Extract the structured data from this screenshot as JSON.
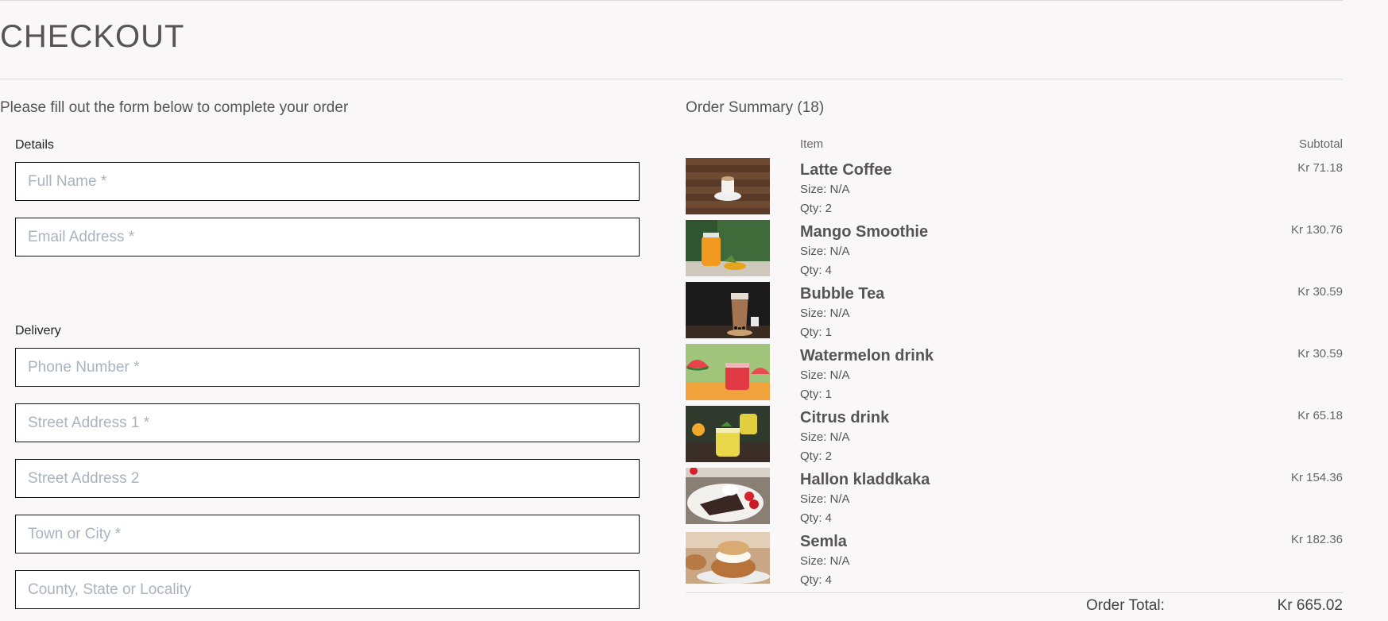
{
  "page": {
    "title": "CHECKOUT"
  },
  "form": {
    "intro": "Please fill out the form below to complete your order",
    "details_legend": "Details",
    "delivery_legend": "Delivery",
    "full_name": {
      "placeholder": "Full Name *",
      "value": ""
    },
    "email": {
      "placeholder": "Email Address *",
      "value": ""
    },
    "phone": {
      "placeholder": "Phone Number *",
      "value": ""
    },
    "street1": {
      "placeholder": "Street Address 1 *",
      "value": ""
    },
    "street2": {
      "placeholder": "Street Address 2",
      "value": ""
    },
    "town": {
      "placeholder": "Town or City *",
      "value": ""
    },
    "county": {
      "placeholder": "County, State or Locality",
      "value": ""
    }
  },
  "summary": {
    "title": "Order Summary (18)",
    "col_item": "Item",
    "col_subtotal": "Subtotal",
    "items": [
      {
        "name": "Latte Coffee",
        "size": "Size: N/A",
        "qty": "Qty: 2",
        "subtotal": "Kr 71.18",
        "thumb_icon": "latte-coffee-photo"
      },
      {
        "name": "Mango Smoothie",
        "size": "Size: N/A",
        "qty": "Qty: 4",
        "subtotal": "Kr 130.76",
        "thumb_icon": "mango-smoothie-photo"
      },
      {
        "name": "Bubble Tea",
        "size": "Size: N/A",
        "qty": "Qty: 1",
        "subtotal": "Kr 30.59",
        "thumb_icon": "bubble-tea-photo"
      },
      {
        "name": "Watermelon drink",
        "size": "Size: N/A",
        "qty": "Qty: 1",
        "subtotal": "Kr 30.59",
        "thumb_icon": "watermelon-drink-photo"
      },
      {
        "name": "Citrus drink",
        "size": "Size: N/A",
        "qty": "Qty: 2",
        "subtotal": "Kr 65.18",
        "thumb_icon": "citrus-drink-photo"
      },
      {
        "name": "Hallon kladdkaka",
        "size": "Size: N/A",
        "qty": "Qty: 4",
        "subtotal": "Kr 154.36",
        "thumb_icon": "hallon-kladdkaka-photo"
      },
      {
        "name": "Semla",
        "size": "Size: N/A",
        "qty": "Qty: 4",
        "subtotal": "Kr 182.36",
        "thumb_icon": "semla-photo"
      }
    ],
    "total_label": "Order Total:",
    "total_value": "Kr 665.02"
  },
  "colors": {
    "background": "#f9f7f7",
    "text": "#555555",
    "field_border": "#111111",
    "placeholder": "#a9b3c0"
  }
}
